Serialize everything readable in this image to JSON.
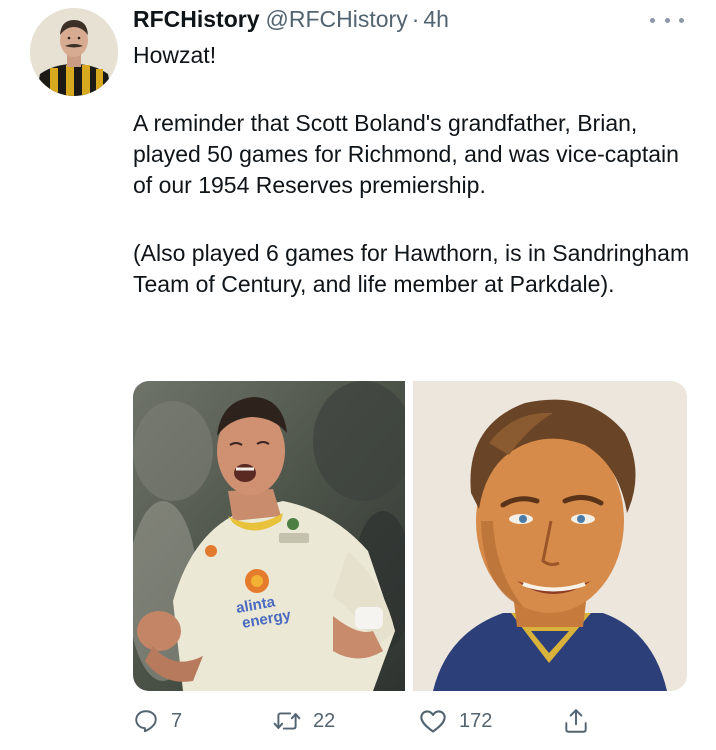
{
  "author": {
    "name": "RFCHistory",
    "handle": "@RFCHistory",
    "separator": "·",
    "time": "4h",
    "avatar_icon": "vintage-footballer-portrait"
  },
  "tweet": {
    "paragraphs": [
      "Howzat!",
      "A reminder that Scott Boland's grandfather, Brian,  played 50 games for Richmond, and was vice-captain of our 1954 Reserves premiership.",
      "(Also played 6 games for Hawthorn, is in Sandringham Team of Century, and life member at Parkdale)."
    ]
  },
  "media": {
    "images": [
      {
        "icon": "cricketer-celebrating-photo",
        "jersey_text": "alinta energy"
      },
      {
        "icon": "painted-portrait"
      }
    ]
  },
  "actions": {
    "reply": {
      "icon": "reply-icon",
      "count": "7"
    },
    "retweet": {
      "icon": "retweet-icon",
      "count": "22"
    },
    "like": {
      "icon": "like-icon",
      "count": "172"
    },
    "share": {
      "icon": "share-icon"
    }
  },
  "colors": {
    "text": "#0f1419",
    "secondary": "#536471",
    "background": "#ffffff"
  }
}
